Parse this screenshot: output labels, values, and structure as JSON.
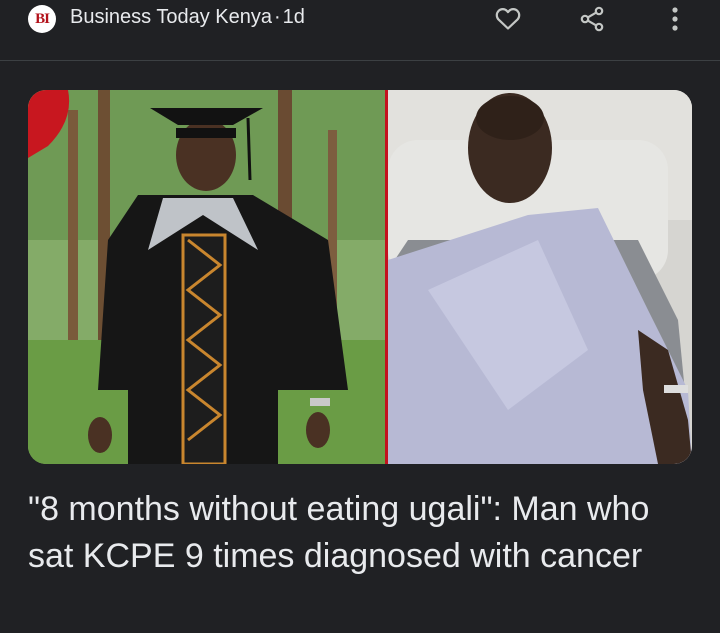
{
  "source": {
    "logo_text": "BI",
    "name": "Business Today Kenya",
    "separator": "·",
    "age": "1d"
  },
  "actions": [
    {
      "name": "favorite",
      "icon": "heart-outline-icon"
    },
    {
      "name": "share",
      "icon": "share-icon"
    },
    {
      "name": "more",
      "icon": "more-vert-icon"
    }
  ],
  "article": {
    "headline": "\"8 months without eating ugali\": Man who sat KCPE 9 times diagnosed with cancer"
  },
  "colors": {
    "background": "#202124",
    "text": "#e8eaed",
    "brand_red": "#b3121b",
    "icon": "#c4c7c5"
  }
}
